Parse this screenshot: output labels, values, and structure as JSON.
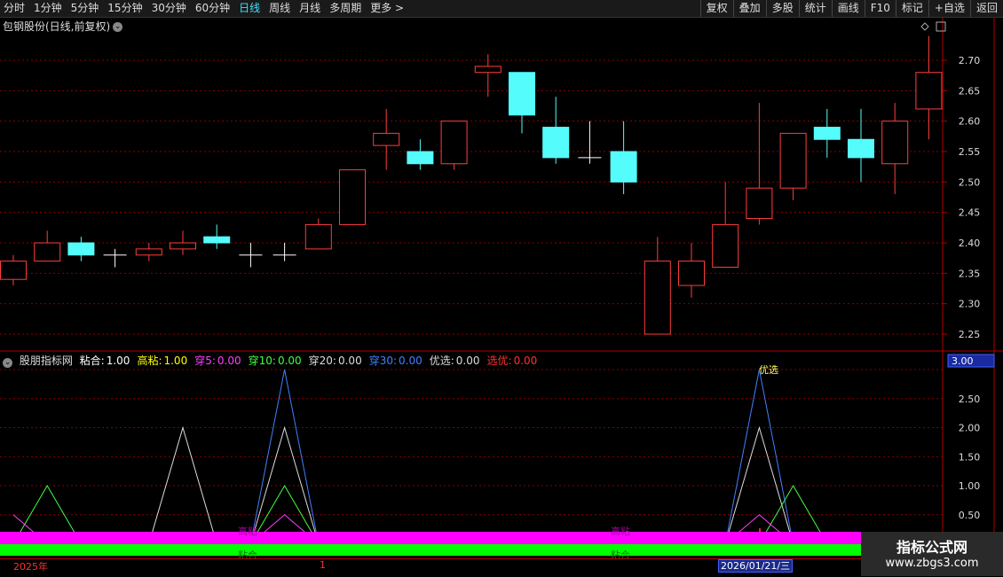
{
  "toolbar": {
    "periods": [
      "分时",
      "1分钟",
      "5分钟",
      "15分钟",
      "30分钟",
      "60分钟",
      "日线",
      "周线",
      "月线",
      "多周期",
      "更多 >"
    ],
    "active_period": "日线",
    "tools": [
      "复权",
      "叠加",
      "多股",
      "统计",
      "画线",
      "F10",
      "标记",
      "+自选",
      "返回"
    ]
  },
  "stock": {
    "title": "包钢股份(日线,前复权)"
  },
  "indicator": {
    "name": "股朋指标网",
    "items": [
      {
        "label": "粘合:",
        "value": "1.00",
        "color": "#ffffff"
      },
      {
        "label": "高粘:",
        "value": "1.00",
        "color": "#ffff00"
      },
      {
        "label": "穿5:",
        "value": "0.00",
        "color": "#ff40ff"
      },
      {
        "label": "穿10:",
        "value": "0.00",
        "color": "#40ff40"
      },
      {
        "label": "穿20:",
        "value": "0.00",
        "color": "#dddddd"
      },
      {
        "label": "穿30:",
        "value": "0.00",
        "color": "#4080ff"
      },
      {
        "label": "优选:",
        "value": "0.00",
        "color": "#dddddd"
      },
      {
        "label": "选优:",
        "value": "0.00",
        "color": "#ff3030"
      }
    ],
    "current_value": "3.00",
    "peak_label": "优选"
  },
  "price_axis": {
    "ticks": [
      "2.70",
      "2.65",
      "2.60",
      "2.55",
      "2.50",
      "2.45",
      "2.40",
      "2.35",
      "2.30",
      "2.25"
    ]
  },
  "ind_axis": {
    "ticks": [
      "3.00",
      "2.50",
      "2.00",
      "1.50",
      "1.00",
      "0.50"
    ]
  },
  "candles": [
    {
      "o": 2.34,
      "c": 2.37,
      "h": 2.38,
      "l": 2.33
    },
    {
      "o": 2.37,
      "c": 2.4,
      "h": 2.42,
      "l": 2.37
    },
    {
      "o": 2.4,
      "c": 2.38,
      "h": 2.41,
      "l": 2.37
    },
    {
      "o": 2.38,
      "c": 2.38,
      "h": 2.39,
      "l": 2.36
    },
    {
      "o": 2.38,
      "c": 2.39,
      "h": 2.4,
      "l": 2.37
    },
    {
      "o": 2.39,
      "c": 2.4,
      "h": 2.42,
      "l": 2.38
    },
    {
      "o": 2.41,
      "c": 2.4,
      "h": 2.43,
      "l": 2.39
    },
    {
      "o": 2.38,
      "c": 2.38,
      "h": 2.4,
      "l": 2.36
    },
    {
      "o": 2.38,
      "c": 2.38,
      "h": 2.4,
      "l": 2.37
    },
    {
      "o": 2.39,
      "c": 2.43,
      "h": 2.44,
      "l": 2.39
    },
    {
      "o": 2.43,
      "c": 2.52,
      "h": 2.52,
      "l": 2.43
    },
    {
      "o": 2.56,
      "c": 2.58,
      "h": 2.62,
      "l": 2.52
    },
    {
      "o": 2.55,
      "c": 2.53,
      "h": 2.57,
      "l": 2.52
    },
    {
      "o": 2.53,
      "c": 2.6,
      "h": 2.6,
      "l": 2.52
    },
    {
      "o": 2.68,
      "c": 2.69,
      "h": 2.71,
      "l": 2.64
    },
    {
      "o": 2.68,
      "c": 2.61,
      "h": 2.68,
      "l": 2.58
    },
    {
      "o": 2.59,
      "c": 2.54,
      "h": 2.64,
      "l": 2.53
    },
    {
      "o": 2.54,
      "c": 2.54,
      "h": 2.6,
      "l": 2.53
    },
    {
      "o": 2.55,
      "c": 2.5,
      "h": 2.6,
      "l": 2.48
    },
    {
      "o": 2.25,
      "c": 2.37,
      "h": 2.41,
      "l": 2.25
    },
    {
      "o": 2.33,
      "c": 2.37,
      "h": 2.4,
      "l": 2.31
    },
    {
      "o": 2.36,
      "c": 2.43,
      "h": 2.5,
      "l": 2.36
    },
    {
      "o": 2.44,
      "c": 2.49,
      "h": 2.63,
      "l": 2.43
    },
    {
      "o": 2.49,
      "c": 2.58,
      "h": 2.58,
      "l": 2.47
    },
    {
      "o": 2.59,
      "c": 2.57,
      "h": 2.62,
      "l": 2.54
    },
    {
      "o": 2.57,
      "c": 2.54,
      "h": 2.62,
      "l": 2.5
    },
    {
      "o": 2.53,
      "c": 2.6,
      "h": 2.63,
      "l": 2.48
    },
    {
      "o": 2.62,
      "c": 2.68,
      "h": 2.74,
      "l": 2.57
    }
  ],
  "ind_series": [
    {
      "name": "穿30",
      "color": "#4080ff",
      "values": [
        0,
        0,
        0,
        0,
        0,
        0,
        0,
        0,
        3,
        0,
        0,
        0,
        0,
        0,
        0,
        0,
        0,
        0,
        0,
        0,
        0,
        0,
        3,
        0,
        0,
        0,
        0,
        0
      ]
    },
    {
      "name": "穿20",
      "color": "#dddddd",
      "values": [
        0,
        0,
        0,
        0,
        0,
        2,
        0,
        0,
        2,
        0,
        0,
        0,
        0,
        0,
        0,
        0,
        0,
        0,
        0,
        0,
        0,
        0,
        2,
        0,
        0,
        0,
        0,
        0
      ]
    },
    {
      "name": "穿10",
      "color": "#40ff40",
      "values": [
        0,
        1,
        0,
        0,
        0,
        0,
        0,
        0,
        1,
        0,
        0,
        0,
        0,
        0,
        0,
        0,
        0,
        0,
        0,
        0,
        0,
        0,
        0,
        1,
        0,
        0,
        0,
        0
      ]
    },
    {
      "name": "穿5",
      "color": "#ff40ff",
      "values": [
        0.5,
        0,
        0,
        0,
        0,
        0,
        0,
        0,
        0.5,
        0,
        0,
        0,
        0,
        0,
        0,
        0,
        0,
        0,
        0,
        0,
        0,
        0,
        0.5,
        0,
        0,
        0,
        0,
        0
      ]
    }
  ],
  "bar_labels": [
    "高粘",
    "高粘"
  ],
  "bar_labels_green": [
    "粘合",
    "粘合"
  ],
  "bottom_axis": {
    "year": "2025年",
    "tick": "1",
    "cursor_date": "2026/01/21/三"
  },
  "watermark": {
    "title": "指标公式网",
    "url": "www.zbgs3.com"
  },
  "colors": {
    "up": "#ff3c3c",
    "down": "#54fcfc",
    "grid": "#8b0000",
    "axis": "#b00000"
  }
}
